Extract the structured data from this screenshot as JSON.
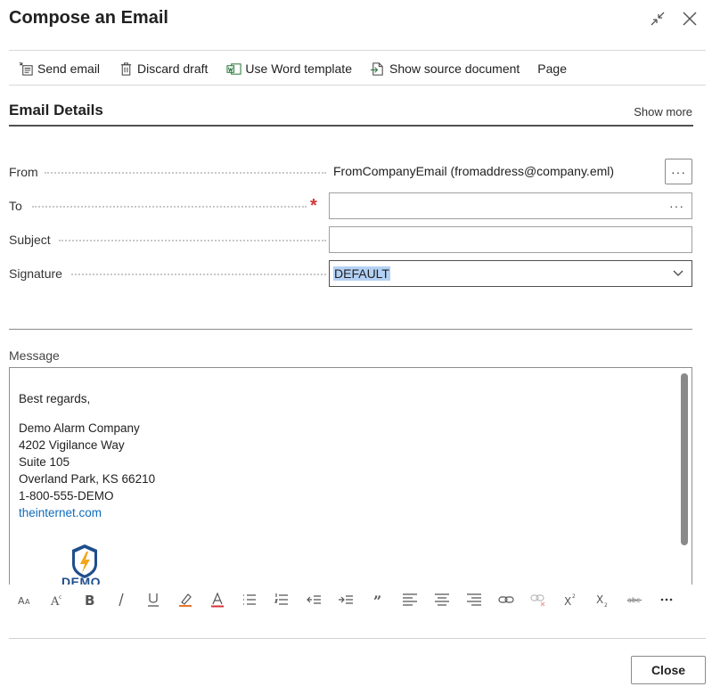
{
  "dialog": {
    "title": "Compose an Email"
  },
  "actions": [
    {
      "label": "Send email",
      "icon": "send-email-icon"
    },
    {
      "label": "Discard draft",
      "icon": "trash-icon"
    },
    {
      "label": "Use Word template",
      "icon": "word-icon"
    },
    {
      "label": "Show source document",
      "icon": "source-document-icon"
    },
    {
      "label": "Page",
      "icon": ""
    }
  ],
  "section": {
    "title": "Email Details",
    "show_more": "Show more"
  },
  "fields": {
    "from_label": "From",
    "from_value": "FromCompanyEmail (fromaddress@company.eml)",
    "from_more": "···",
    "to_label": "To",
    "to_value": "",
    "to_more": "···",
    "subject_label": "Subject",
    "subject_value": "",
    "signature_label": "Signature",
    "signature_value": "DEFAULT"
  },
  "message": {
    "label": "Message",
    "greeting": "Best regards,",
    "company": "Demo Alarm Company",
    "address1": "4202 Vigilance Way",
    "address2": "Suite 105",
    "city": "Overland Park, KS 66210",
    "phone": "1-800-555-DEMO",
    "website": "theinternet.com",
    "logo_text": "DEMO"
  },
  "footer": {
    "close_label": "Close"
  },
  "colors": {
    "link": "#0f6cbd",
    "required": "#d13438",
    "selection": "#b3d1f5"
  }
}
